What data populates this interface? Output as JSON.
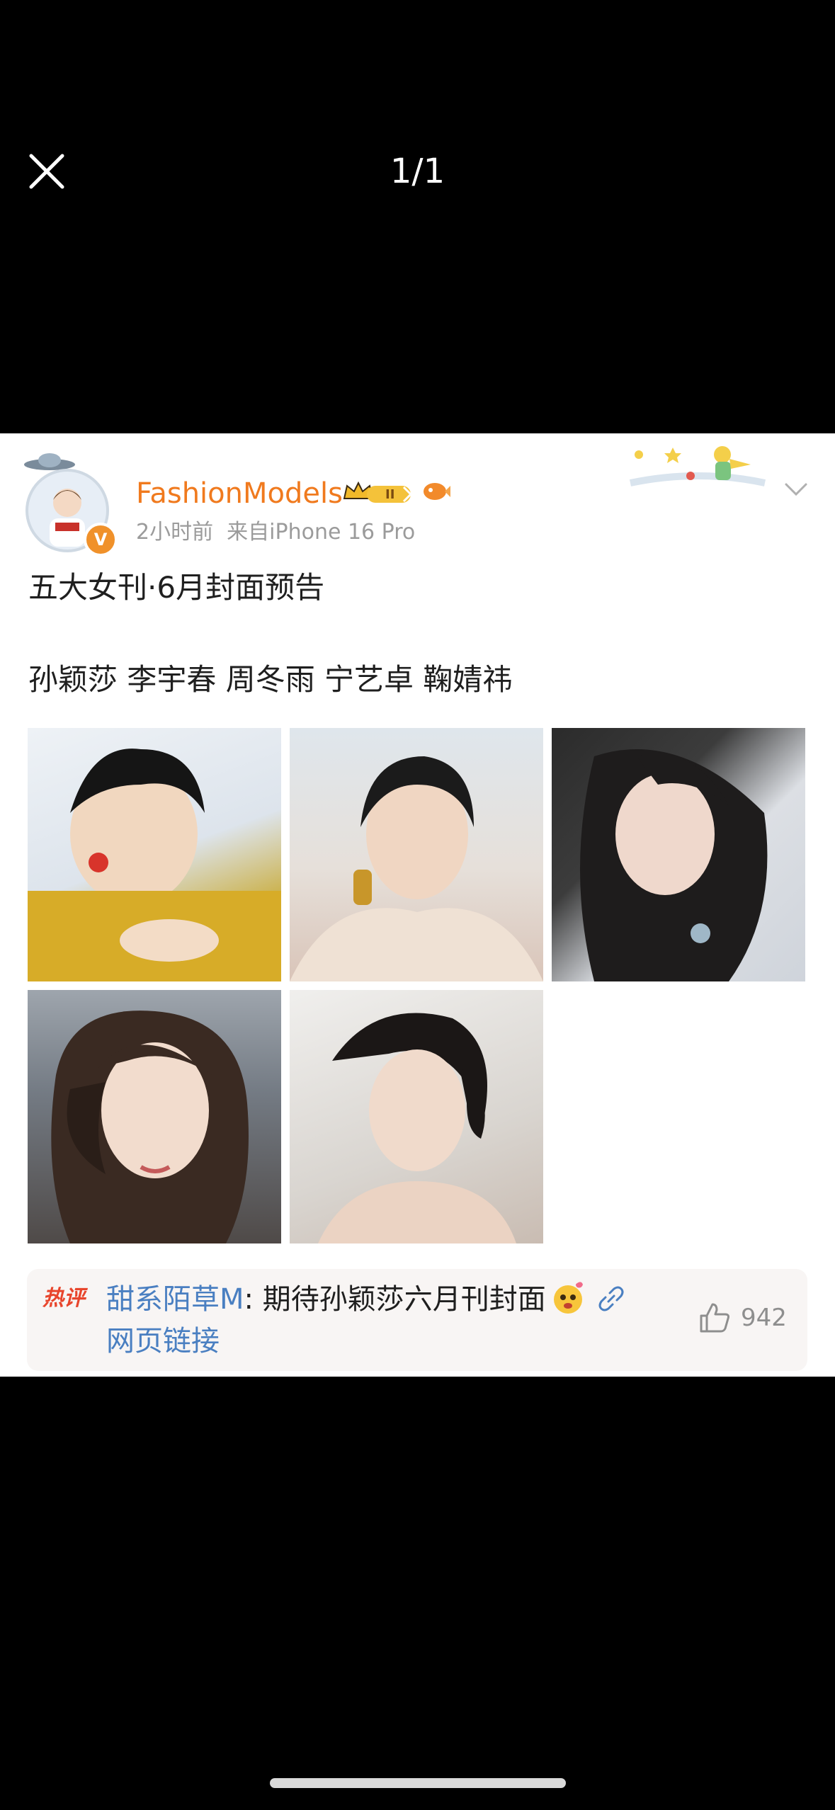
{
  "viewer": {
    "pager": "1/1"
  },
  "post": {
    "author": "FashionModels",
    "timestamp": "2小时前",
    "source": "来自iPhone 16 Pro",
    "verified_badge": "V",
    "text_line1": "五大女刊·6月封面预告",
    "text_line2": "孙颖莎 李宇春 周冬雨 宁艺卓 鞠婧祎",
    "photo_count": 5
  },
  "hot_comment": {
    "tag": "热评",
    "author": "甜系陌草M",
    "text": ": 期待孙颖莎六月刊封面",
    "link_text": "网页链接",
    "likes": "942"
  },
  "colors": {
    "author_orange": "#f07a1e",
    "link_blue": "#4a7fc1",
    "hot_red": "#e8452c"
  }
}
